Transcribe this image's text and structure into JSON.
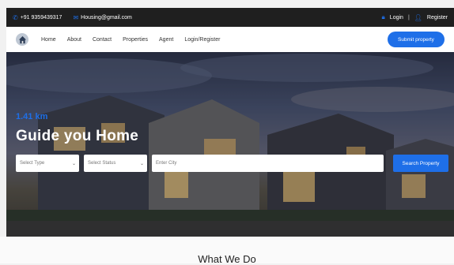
{
  "topbar": {
    "phone": "+91 9359439317",
    "email": "Housing@gmail.com",
    "login": "Login",
    "separator": "|",
    "register": "Register"
  },
  "nav": {
    "links": [
      "Home",
      "About",
      "Contact",
      "Properties",
      "Agent",
      "Login/Register"
    ],
    "submit": "Submit property"
  },
  "hero": {
    "subtitle": "1.41 km",
    "title": "Guide you Home",
    "select_type": "Select Type",
    "select_status": "Select Status",
    "city_placeholder": "Enter City",
    "search_button": "Search Property"
  },
  "section": {
    "title": "What We Do"
  },
  "colors": {
    "accent": "#1e6fe8",
    "topbar_bg": "#1f1f1f"
  }
}
